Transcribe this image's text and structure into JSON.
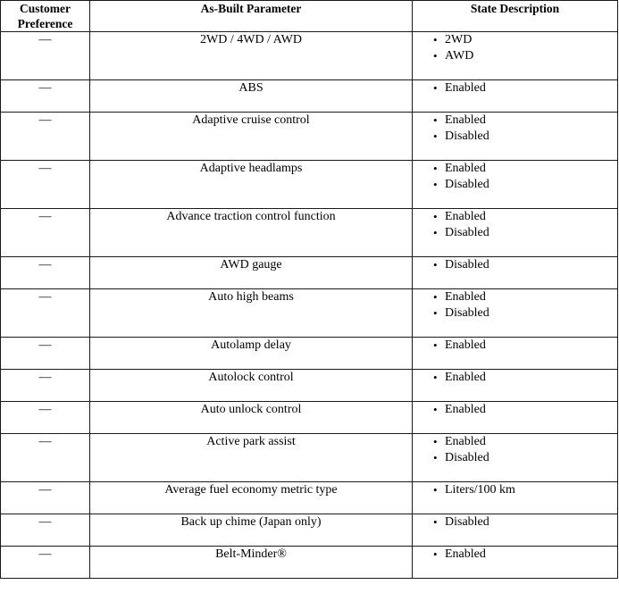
{
  "table": {
    "columns": [
      {
        "key": "customer_preference",
        "label": "Customer\nPreference",
        "align": "center"
      },
      {
        "key": "as_built_parameter",
        "label": "As-Built Parameter",
        "align": "center"
      },
      {
        "key": "state_description",
        "label": "State Description",
        "align": "center"
      }
    ],
    "bullet_glyph": "•",
    "dash_glyph": "—",
    "rows": [
      {
        "customer_preference": "—",
        "as_built_parameter": "2WD / 4WD / AWD",
        "state_description": [
          "2WD",
          "AWD"
        ],
        "height": 54
      },
      {
        "customer_preference": "—",
        "as_built_parameter": "ABS",
        "state_description": [
          "Enabled"
        ],
        "height": 36
      },
      {
        "customer_preference": "—",
        "as_built_parameter": "Adaptive cruise control",
        "state_description": [
          "Enabled",
          "Disabled"
        ],
        "height": 54
      },
      {
        "customer_preference": "—",
        "as_built_parameter": "Adaptive headlamps",
        "state_description": [
          "Enabled",
          "Disabled"
        ],
        "height": 54
      },
      {
        "customer_preference": "—",
        "as_built_parameter": "Advance traction control function",
        "state_description": [
          "Enabled",
          "Disabled"
        ],
        "height": 54
      },
      {
        "customer_preference": "—",
        "as_built_parameter": "AWD gauge",
        "state_description": [
          "Disabled"
        ],
        "height": 36
      },
      {
        "customer_preference": "—",
        "as_built_parameter": "Auto high beams",
        "state_description": [
          "Enabled",
          "Disabled"
        ],
        "height": 54
      },
      {
        "customer_preference": "—",
        "as_built_parameter": "Autolamp delay",
        "state_description": [
          "Enabled"
        ],
        "height": 36
      },
      {
        "customer_preference": "—",
        "as_built_parameter": "Autolock control",
        "state_description": [
          "Enabled"
        ],
        "height": 36
      },
      {
        "customer_preference": "—",
        "as_built_parameter": "Auto unlock control",
        "state_description": [
          "Enabled"
        ],
        "height": 36
      },
      {
        "customer_preference": "—",
        "as_built_parameter": "Active park assist",
        "state_description": [
          "Enabled",
          "Disabled"
        ],
        "height": 54
      },
      {
        "customer_preference": "—",
        "as_built_parameter": "Average fuel economy metric type",
        "state_description": [
          "Liters/100 km"
        ],
        "height": 36
      },
      {
        "customer_preference": "—",
        "as_built_parameter": "Back up chime (Japan only)",
        "state_description": [
          "Disabled"
        ],
        "height": 36
      },
      {
        "customer_preference": "—",
        "as_built_parameter": "Belt-Minder®",
        "state_description": [
          "Enabled"
        ],
        "height": 36
      }
    ]
  }
}
